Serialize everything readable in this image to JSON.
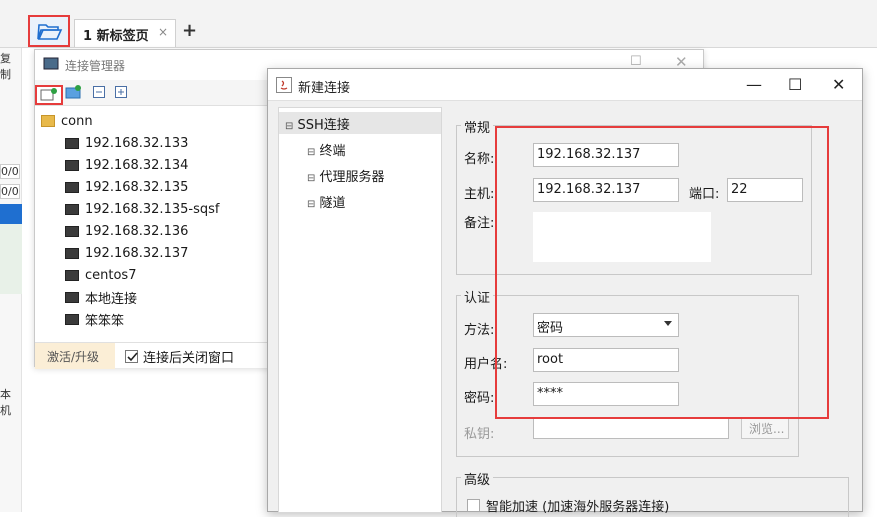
{
  "tabbar": {
    "tab_label": "1 新标签页",
    "tab_close": "×",
    "add_tab": "+"
  },
  "left_strip": {
    "copy_text": "复制",
    "field1": "0/0",
    "field2": "0/0",
    "local_text": "本机"
  },
  "conn_manager": {
    "title": "连接管理器",
    "tree": {
      "root": "conn",
      "items": [
        "192.168.32.133",
        "192.168.32.134",
        "192.168.32.135",
        "192.168.32.135-sqsf",
        "192.168.32.136",
        "192.168.32.137",
        "centos7",
        "本地连接",
        "笨笨笨"
      ]
    },
    "footer": {
      "activate_label": "激活/升级",
      "close_after_connect_label": "连接后关闭窗口",
      "close_after_connect_checked": true
    }
  },
  "dialog": {
    "title": "新建连接",
    "tree": {
      "root": "SSH连接",
      "children": [
        "终端",
        "代理服务器",
        "隧道"
      ]
    },
    "general": {
      "group_label": "常规",
      "name_label": "名称:",
      "name_value": "192.168.32.137",
      "host_label": "主机:",
      "host_value": "192.168.32.137",
      "port_label": "端口:",
      "port_value": "22",
      "note_label": "备注:",
      "note_value": ""
    },
    "auth": {
      "group_label": "认证",
      "method_label": "方法:",
      "method_value": "密码",
      "user_label": "用户名:",
      "user_value": "root",
      "password_label": "密码:",
      "password_value": "****",
      "private_key_label": "私钥:",
      "browse_label": "浏览..."
    },
    "advanced": {
      "group_label": "高级",
      "smart_accel_label": "智能加速 (加速海外服务器连接)"
    }
  },
  "colors": {
    "highlight_red": "#e63c3c",
    "activate_bg": "#fbeed6"
  }
}
